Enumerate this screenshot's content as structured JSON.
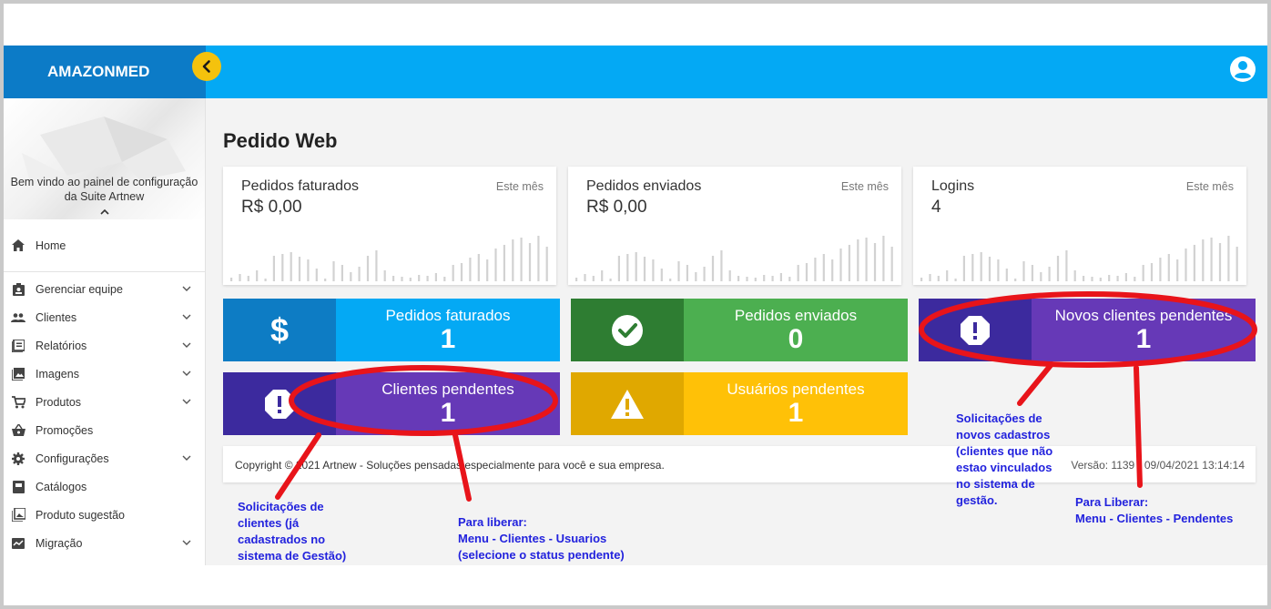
{
  "app": {
    "brand": "AMAZONMED",
    "collapse_icon": "chevron-left-icon",
    "user_icon": "account-circle-icon"
  },
  "sidebar": {
    "welcome": "Bem vindo ao painel de configuração da Suite Artnew",
    "caret": "^",
    "home": "Home",
    "items": [
      {
        "label": "Gerenciar equipe",
        "icon": "badge-icon",
        "expandable": true
      },
      {
        "label": "Clientes",
        "icon": "people-icon",
        "expandable": true
      },
      {
        "label": "Relatórios",
        "icon": "report-icon",
        "expandable": true
      },
      {
        "label": "Imagens",
        "icon": "image-icon",
        "expandable": true
      },
      {
        "label": "Produtos",
        "icon": "cart-icon",
        "expandable": true
      },
      {
        "label": "Promoções",
        "icon": "basket-icon",
        "expandable": false
      },
      {
        "label": "Configurações",
        "icon": "gear-icon",
        "expandable": true
      },
      {
        "label": "Catálogos",
        "icon": "book-icon",
        "expandable": false
      },
      {
        "label": "Produto sugestão",
        "icon": "gallery-icon",
        "expandable": false
      },
      {
        "label": "Migração",
        "icon": "migration-icon",
        "expandable": true
      }
    ]
  },
  "main": {
    "title": "Pedido Web",
    "stat_cards": [
      {
        "label": "Pedidos faturados",
        "value": "R$ 0,00",
        "period": "Este mês"
      },
      {
        "label": "Pedidos enviados",
        "value": "R$ 0,00",
        "period": "Este mês"
      },
      {
        "label": "Logins",
        "value": "4",
        "period": "Este mês"
      }
    ],
    "tiles": [
      {
        "title": "Pedidos faturados",
        "value": "1",
        "icon": "dollar-icon",
        "color_left": "#0d7cc4",
        "color_right": "#04a9f4"
      },
      {
        "title": "Pedidos enviados",
        "value": "0",
        "icon": "check-circle-icon",
        "color_left": "#2e7d32",
        "color_right": "#4caf50"
      },
      {
        "title": "Novos clientes pendentes",
        "value": "1",
        "icon": "alert-octagon-icon",
        "color_left": "#3c2a9e",
        "color_right": "#6639b7"
      },
      {
        "title": "Clientes pendentes",
        "value": "1",
        "icon": "alert-octagon-icon",
        "color_left": "#3c2a9e",
        "color_right": "#6639b7"
      },
      {
        "title": "Usuários pendentes",
        "value": "1",
        "icon": "warning-icon",
        "color_left": "#e0a800",
        "color_right": "#ffc107"
      }
    ],
    "footer": {
      "copyright": "Copyright © 2021 Artnew - Soluções pensadas especialmente para você e sua empresa.",
      "version": "Versão: 1139 - 09/04/2021 13:14:14"
    }
  },
  "annotations": {
    "clientes_solicitacoes": [
      "Solicitações de",
      "clientes (já",
      "cadastrados no",
      "sistema de Gestão)"
    ],
    "para_liberar_usuarios": [
      "Para liberar:",
      "Menu - Clientes - Usuarios",
      "(selecione o status pendente)"
    ],
    "novos_cadastros": [
      "Solicitações de",
      "novos cadastros",
      "(clientes que não",
      "estao vinculados",
      "no sistema de",
      "gestão."
    ],
    "para_liberar_pendentes": [
      "Para Liberar:",
      "Menu - Clientes - Pendentes"
    ]
  }
}
